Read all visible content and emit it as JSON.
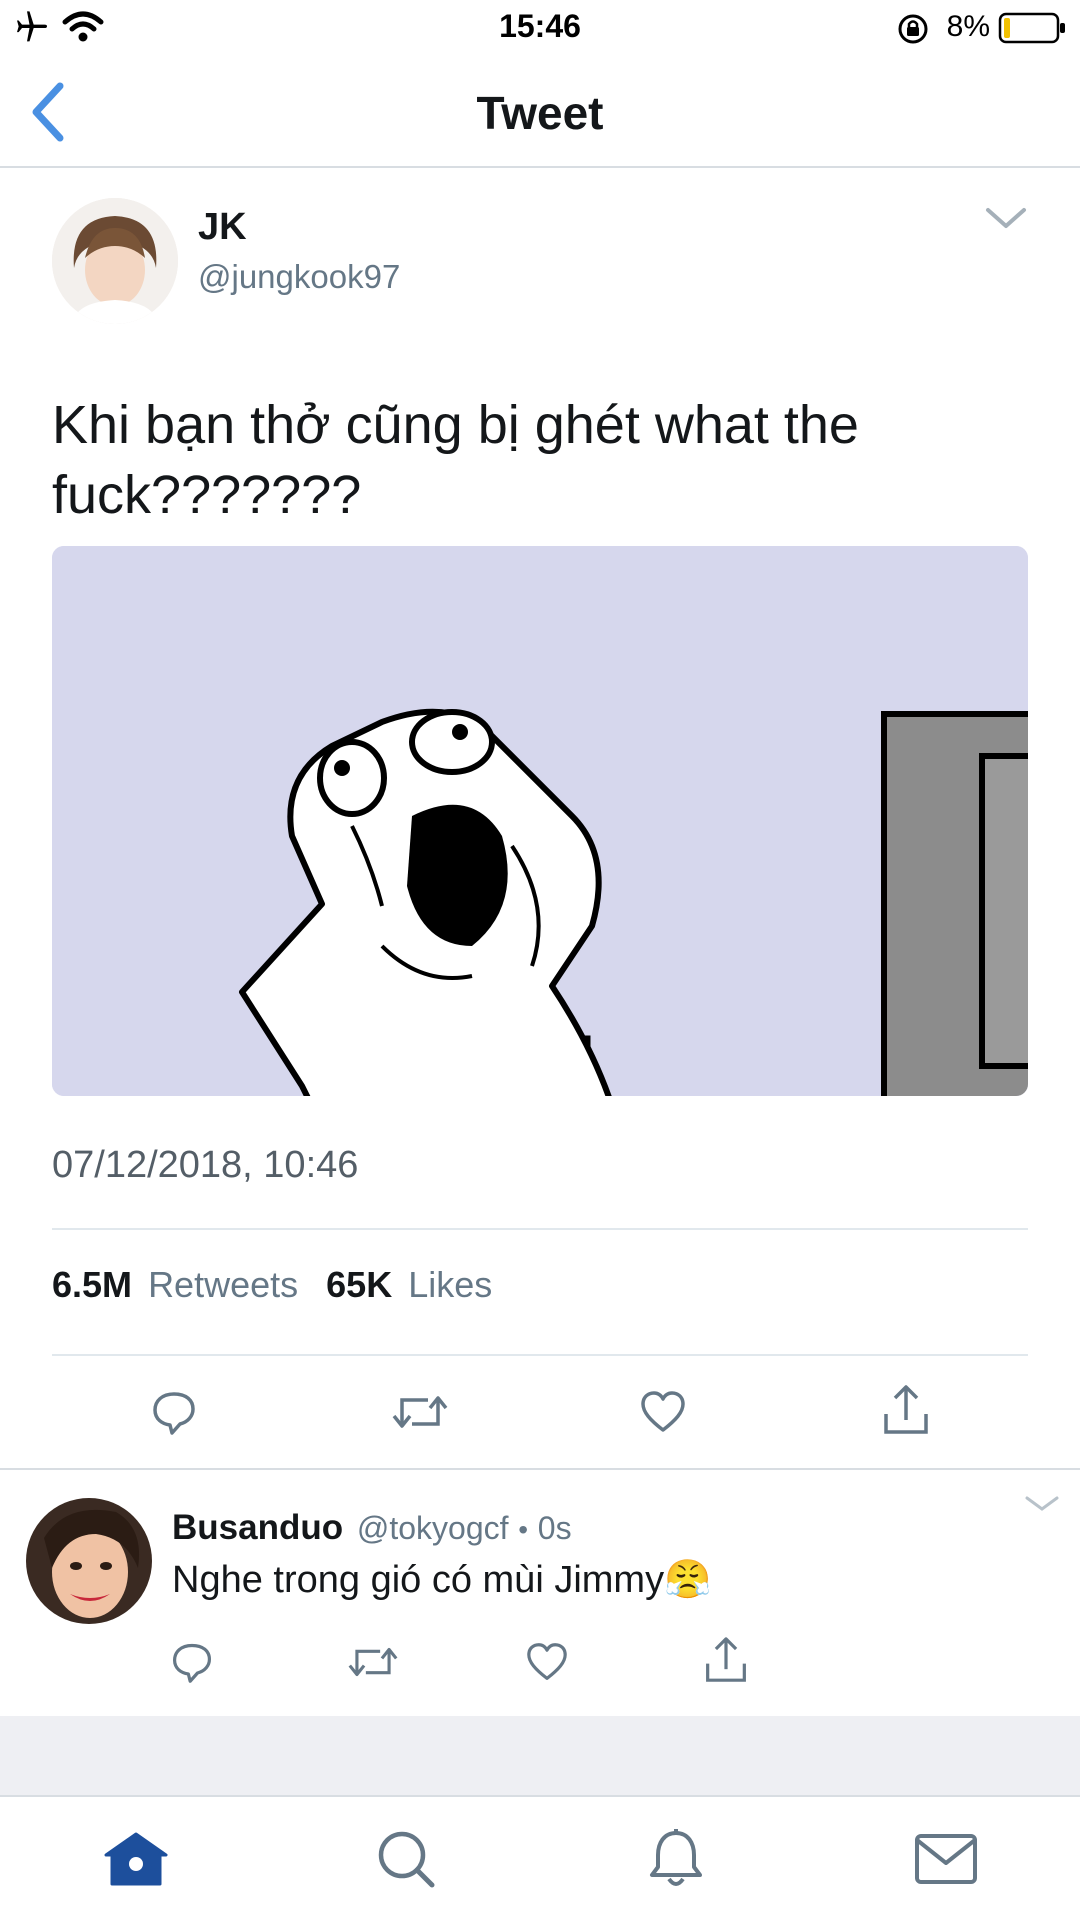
{
  "status_bar": {
    "time": "15:46",
    "battery": "8%"
  },
  "header": {
    "title": "Tweet"
  },
  "tweet": {
    "display_name": "JK",
    "handle": "@jungkook97",
    "text": "Khi bạn thở cũng bị ghét what the fuck???????",
    "timestamp": "07/12/2018, 10:46",
    "retweet_count": "6.5M",
    "retweet_label": "Retweets",
    "like_count": "65K",
    "like_label": "Likes"
  },
  "reply": {
    "display_name": "Busanduo",
    "handle": "@tokyogcf",
    "separator": "•",
    "age": "0s",
    "text": "Nghe trong gió có mùi Jimmy😤"
  },
  "colors": {
    "accent": "#4a90e2",
    "tab_active": "#1d4f9c",
    "icon_gray": "#657786",
    "image_bg": "#d6d7ed"
  },
  "icons": [
    "back-chevron-icon",
    "airplane-icon",
    "wifi-icon",
    "rotation-lock-icon",
    "battery-icon",
    "chevron-down-icon",
    "reply-icon",
    "retweet-icon",
    "heart-icon",
    "share-icon",
    "home-icon",
    "search-icon",
    "bell-icon",
    "mail-icon"
  ]
}
